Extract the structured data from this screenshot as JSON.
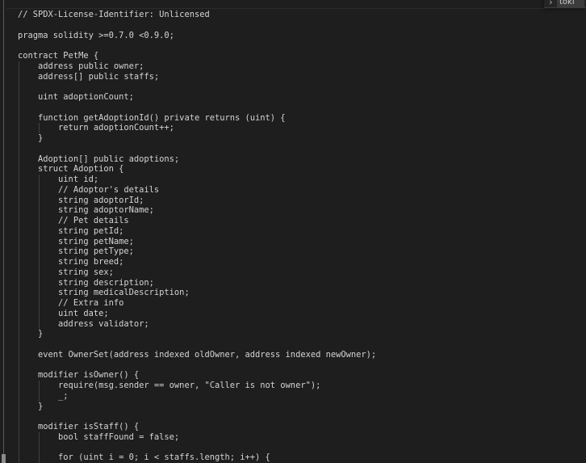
{
  "find_widget": {
    "toggle_icon": "chevron-right-icon",
    "value": "toki"
  },
  "code_lines": [
    {
      "indent": 0,
      "text": "// SPDX-License-Identifier: Unlicensed"
    },
    {
      "indent": 0,
      "text": ""
    },
    {
      "indent": 0,
      "text": "pragma solidity >=0.7.0 <0.9.0;"
    },
    {
      "indent": 0,
      "text": ""
    },
    {
      "indent": 0,
      "text": "contract PetMe {"
    },
    {
      "indent": 1,
      "text": "address public owner;"
    },
    {
      "indent": 1,
      "text": "address[] public staffs;"
    },
    {
      "indent": 1,
      "text": ""
    },
    {
      "indent": 1,
      "text": "uint adoptionCount;"
    },
    {
      "indent": 1,
      "text": ""
    },
    {
      "indent": 1,
      "text": "function getAdoptionId() private returns (uint) {"
    },
    {
      "indent": 2,
      "text": "return adoptionCount++;"
    },
    {
      "indent": 1,
      "text": "}"
    },
    {
      "indent": 1,
      "text": ""
    },
    {
      "indent": 1,
      "text": "Adoption[] public adoptions;"
    },
    {
      "indent": 1,
      "text": "struct Adoption {"
    },
    {
      "indent": 2,
      "text": "uint id;"
    },
    {
      "indent": 2,
      "text": "// Adoptor's details"
    },
    {
      "indent": 2,
      "text": "string adoptorId;"
    },
    {
      "indent": 2,
      "text": "string adoptorName;"
    },
    {
      "indent": 2,
      "text": "// Pet details"
    },
    {
      "indent": 2,
      "text": "string petId;"
    },
    {
      "indent": 2,
      "text": "string petName;"
    },
    {
      "indent": 2,
      "text": "string petType;"
    },
    {
      "indent": 2,
      "text": "string breed;"
    },
    {
      "indent": 2,
      "text": "string sex;"
    },
    {
      "indent": 2,
      "text": "string description;"
    },
    {
      "indent": 2,
      "text": "string medicalDescription;"
    },
    {
      "indent": 2,
      "text": "// Extra info"
    },
    {
      "indent": 2,
      "text": "uint date;"
    },
    {
      "indent": 2,
      "text": "address validator;"
    },
    {
      "indent": 1,
      "text": "}"
    },
    {
      "indent": 1,
      "text": ""
    },
    {
      "indent": 1,
      "text": "event OwnerSet(address indexed oldOwner, address indexed newOwner);"
    },
    {
      "indent": 1,
      "text": ""
    },
    {
      "indent": 1,
      "text": "modifier isOwner() {"
    },
    {
      "indent": 2,
      "text": "require(msg.sender == owner, \"Caller is not owner\");"
    },
    {
      "indent": 2,
      "text": "_;"
    },
    {
      "indent": 1,
      "text": "}"
    },
    {
      "indent": 1,
      "text": ""
    },
    {
      "indent": 1,
      "text": "modifier isStaff() {"
    },
    {
      "indent": 2,
      "text": "bool staffFound = false;"
    },
    {
      "indent": 2,
      "text": ""
    },
    {
      "indent": 2,
      "text": "for (uint i = 0; i < staffs.length; i++) {"
    }
  ]
}
